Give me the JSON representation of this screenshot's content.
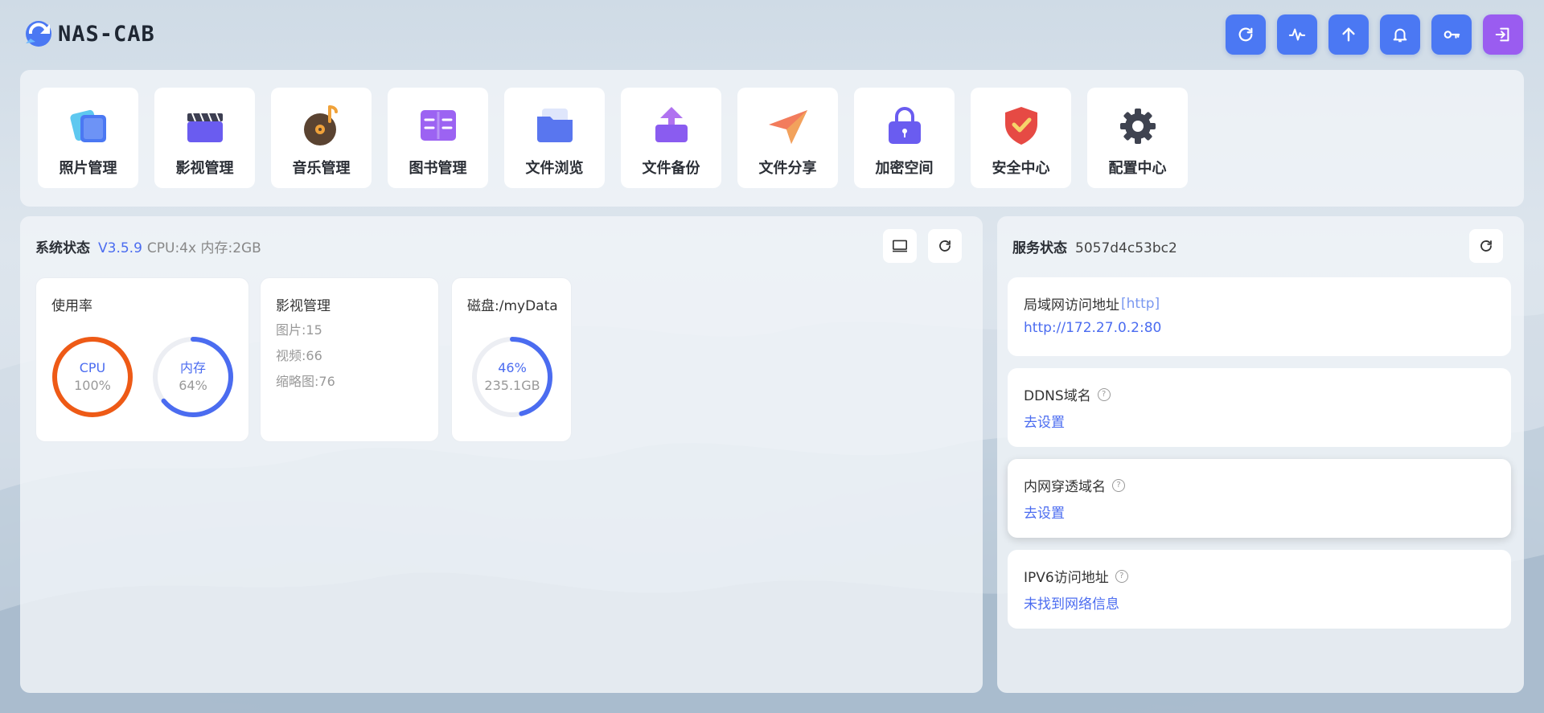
{
  "app": {
    "name": "NAS-CAB"
  },
  "colors": {
    "accent": "#4b78f3",
    "accent_purple": "#9a5cf0",
    "cpu_ring": "#ee5a16",
    "mem_ring": "#4b6cf0",
    "link": "#4b6cf0"
  },
  "toolbar": [
    {
      "icon": "refresh-icon"
    },
    {
      "icon": "pulse-icon"
    },
    {
      "icon": "upload-icon"
    },
    {
      "icon": "bell-icon"
    },
    {
      "icon": "key-icon"
    },
    {
      "icon": "logout-icon"
    }
  ],
  "apps": [
    {
      "label": "照片管理",
      "icon": "photos-icon"
    },
    {
      "label": "影视管理",
      "icon": "video-icon"
    },
    {
      "label": "音乐管理",
      "icon": "music-icon"
    },
    {
      "label": "图书管理",
      "icon": "book-icon"
    },
    {
      "label": "文件浏览",
      "icon": "folder-icon"
    },
    {
      "label": "文件备份",
      "icon": "backup-icon"
    },
    {
      "label": "文件分享",
      "icon": "share-icon"
    },
    {
      "label": "加密空间",
      "icon": "lock-icon"
    },
    {
      "label": "安全中心",
      "icon": "shield-icon"
    },
    {
      "label": "配置中心",
      "icon": "gear-icon"
    }
  ],
  "system": {
    "title": "系统状态",
    "version": "V3.5.9",
    "specs": "CPU:4x 内存:2GB",
    "usage": {
      "title": "使用率",
      "cpu": {
        "label": "CPU",
        "value": "100%",
        "fraction": 1.0
      },
      "mem": {
        "label": "内存",
        "value": "64%",
        "fraction": 0.64
      }
    },
    "media": {
      "title": "影视管理",
      "photos": "图片:15",
      "videos": "视频:66",
      "thumbs": "缩略图:76"
    },
    "disk": {
      "title": "磁盘:/myData",
      "percent": "46%",
      "size": "235.1GB",
      "fraction": 0.46
    }
  },
  "service": {
    "title": "服务状态",
    "id": "5057d4c53bc2",
    "items": [
      {
        "label": "局域网访问地址",
        "tag": "[http]",
        "value": "http://172.27.0.2:80"
      },
      {
        "label": "DDNS域名",
        "help": "?",
        "value": "去设置"
      },
      {
        "label": "内网穿透域名",
        "help": "?",
        "value": "去设置"
      },
      {
        "label": "IPV6访问地址",
        "help": "?",
        "value": "未找到网络信息"
      }
    ]
  }
}
